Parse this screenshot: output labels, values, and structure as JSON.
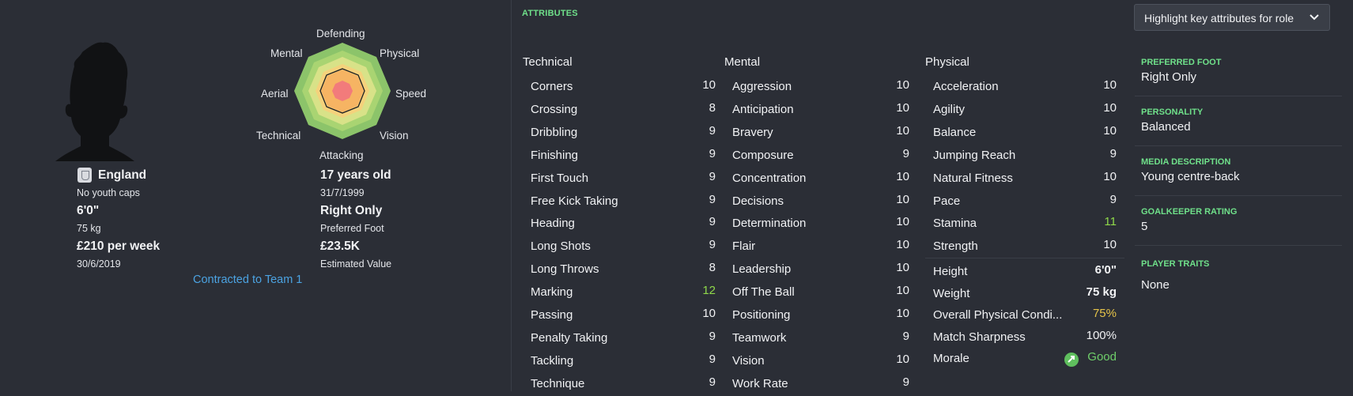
{
  "attributes_title": "ATTRIBUTES",
  "highlight_dropdown": {
    "label": "Highlight key attributes for role"
  },
  "radar": {
    "labels": [
      "Defending",
      "Physical",
      "Speed",
      "Vision",
      "Attacking",
      "Technical",
      "Aerial",
      "Mental"
    ]
  },
  "profile": {
    "nationality": "England",
    "youth_caps": "No youth caps",
    "height": "6'0\"",
    "weight": "75 kg",
    "wage": "£210 per week",
    "contract_end": "30/6/2019",
    "age": "17 years old",
    "dob": "31/7/1999",
    "foot": "Right Only",
    "foot_label": "Preferred Foot",
    "value": "£23.5K",
    "value_label": "Estimated Value",
    "contract_status": "Contracted to Team 1"
  },
  "technical": {
    "title": "Technical",
    "items": [
      {
        "name": "Corners",
        "value": "10"
      },
      {
        "name": "Crossing",
        "value": "8"
      },
      {
        "name": "Dribbling",
        "value": "9"
      },
      {
        "name": "Finishing",
        "value": "9"
      },
      {
        "name": "First Touch",
        "value": "9"
      },
      {
        "name": "Free Kick Taking",
        "value": "9"
      },
      {
        "name": "Heading",
        "value": "9"
      },
      {
        "name": "Long Shots",
        "value": "9"
      },
      {
        "name": "Long Throws",
        "value": "8"
      },
      {
        "name": "Marking",
        "value": "12"
      },
      {
        "name": "Passing",
        "value": "10"
      },
      {
        "name": "Penalty Taking",
        "value": "9"
      },
      {
        "name": "Tackling",
        "value": "9"
      },
      {
        "name": "Technique",
        "value": "9"
      }
    ]
  },
  "mental": {
    "title": "Mental",
    "items": [
      {
        "name": "Aggression",
        "value": "10"
      },
      {
        "name": "Anticipation",
        "value": "10"
      },
      {
        "name": "Bravery",
        "value": "10"
      },
      {
        "name": "Composure",
        "value": "9"
      },
      {
        "name": "Concentration",
        "value": "10"
      },
      {
        "name": "Decisions",
        "value": "10"
      },
      {
        "name": "Determination",
        "value": "10"
      },
      {
        "name": "Flair",
        "value": "10"
      },
      {
        "name": "Leadership",
        "value": "10"
      },
      {
        "name": "Off The Ball",
        "value": "10"
      },
      {
        "name": "Positioning",
        "value": "10"
      },
      {
        "name": "Teamwork",
        "value": "9"
      },
      {
        "name": "Vision",
        "value": "10"
      },
      {
        "name": "Work Rate",
        "value": "9"
      }
    ]
  },
  "physical": {
    "title": "Physical",
    "items": [
      {
        "name": "Acceleration",
        "value": "10"
      },
      {
        "name": "Agility",
        "value": "10"
      },
      {
        "name": "Balance",
        "value": "10"
      },
      {
        "name": "Jumping Reach",
        "value": "9"
      },
      {
        "name": "Natural Fitness",
        "value": "10"
      },
      {
        "name": "Pace",
        "value": "9"
      },
      {
        "name": "Stamina",
        "value": "11"
      },
      {
        "name": "Strength",
        "value": "10"
      }
    ],
    "details": [
      {
        "name": "Height",
        "value": "6'0\""
      },
      {
        "name": "Weight",
        "value": "75 kg"
      },
      {
        "name": "Overall Physical Condi...",
        "value": "75%"
      },
      {
        "name": "Match Sharpness",
        "value": "100%"
      },
      {
        "name": "Morale",
        "value": "Good"
      }
    ]
  },
  "info": {
    "preferred_foot_label": "PREFERRED FOOT",
    "preferred_foot": "Right Only",
    "personality_label": "PERSONALITY",
    "personality": "Balanced",
    "media_label": "MEDIA DESCRIPTION",
    "media": "Young centre-back",
    "gk_label": "GOALKEEPER RATING",
    "gk": "5",
    "traits_label": "PLAYER TRAITS",
    "traits": "None"
  },
  "colors": {
    "background": "#2b2e36",
    "accent_green": "#6fe08a",
    "link_blue": "#4ba3e2",
    "good_value": "#8fd84a",
    "amber_value": "#e6c44a"
  }
}
